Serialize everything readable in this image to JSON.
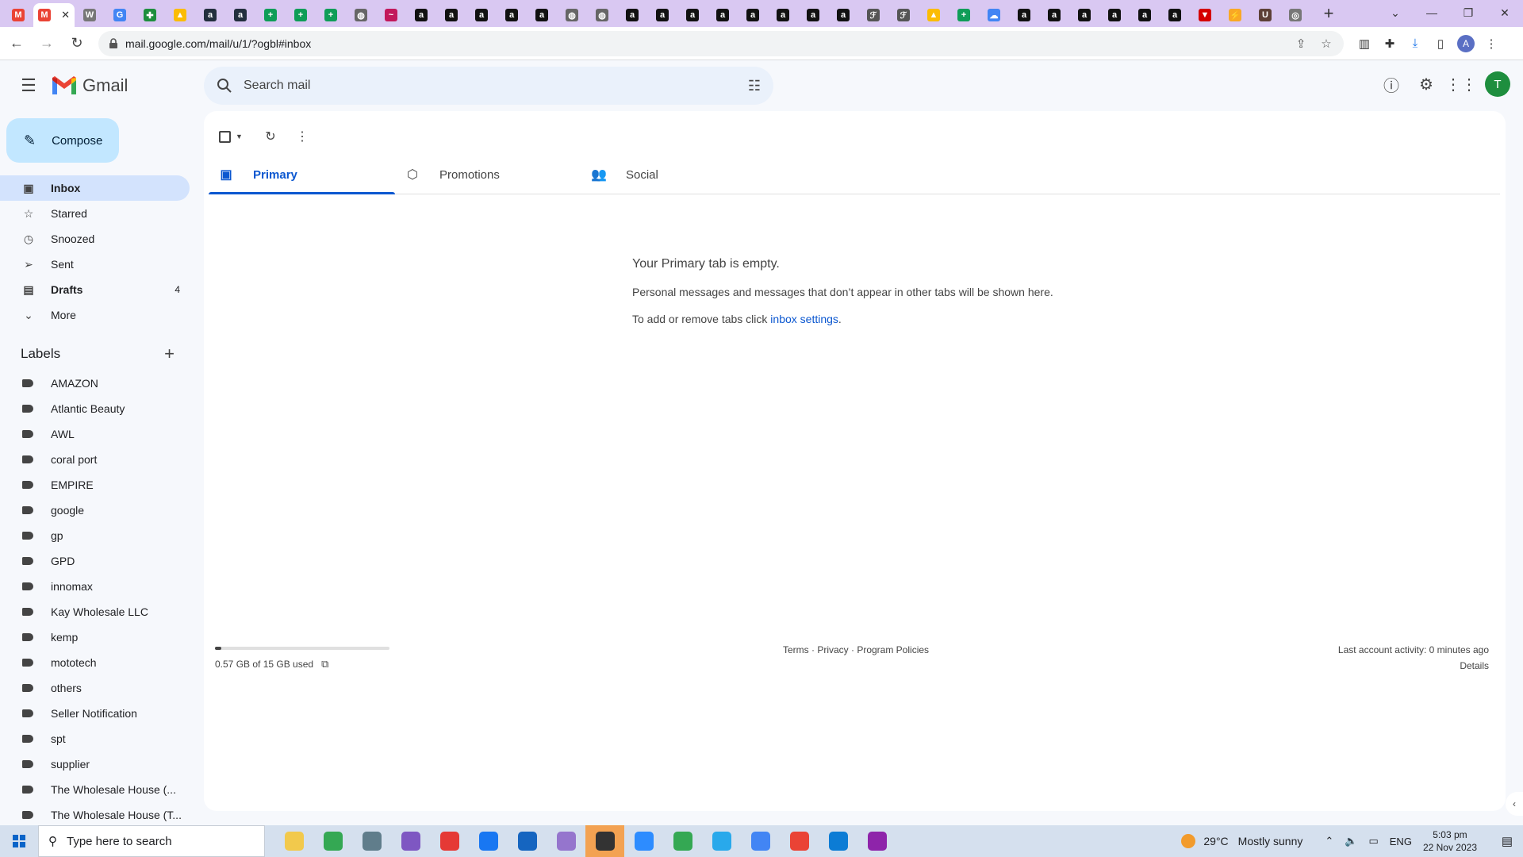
{
  "browser": {
    "tabs": [
      {
        "icon": "gmail-icon",
        "color": "#ea4335",
        "glyph": "M"
      },
      {
        "icon": "gmail-icon",
        "color": "#ea4335",
        "glyph": "M",
        "active": true,
        "close": "✕"
      },
      {
        "icon": "wiki-icon",
        "color": "#777777",
        "glyph": "W"
      },
      {
        "icon": "google-icon",
        "color": "#4285f4",
        "glyph": "G"
      },
      {
        "icon": "puzzle-icon",
        "color": "#1e8e3e",
        "glyph": "✚"
      },
      {
        "icon": "drive-icon",
        "color": "#fbbc04",
        "glyph": "▲"
      },
      {
        "icon": "amazon-icon",
        "color": "#232f3e",
        "glyph": "a"
      },
      {
        "icon": "amazon-icon",
        "color": "#232f3e",
        "glyph": "a"
      },
      {
        "icon": "sheets-icon",
        "color": "#0f9d58",
        "glyph": "+"
      },
      {
        "icon": "sheets-icon",
        "color": "#0f9d58",
        "glyph": "+"
      },
      {
        "icon": "sheets-icon",
        "color": "#0f9d58",
        "glyph": "+"
      },
      {
        "icon": "globe-icon",
        "color": "#666666",
        "glyph": "◍"
      },
      {
        "icon": "site-icon",
        "color": "#c2185b",
        "glyph": "~"
      },
      {
        "icon": "amazon-icon",
        "color": "#111111",
        "glyph": "a"
      },
      {
        "icon": "amazon-icon",
        "color": "#111111",
        "glyph": "a"
      },
      {
        "icon": "amazon-icon",
        "color": "#111111",
        "glyph": "a"
      },
      {
        "icon": "amazon-icon",
        "color": "#111111",
        "glyph": "a"
      },
      {
        "icon": "amazon-icon",
        "color": "#111111",
        "glyph": "a"
      },
      {
        "icon": "globe-icon",
        "color": "#666666",
        "glyph": "◍"
      },
      {
        "icon": "globe-icon",
        "color": "#666666",
        "glyph": "◍"
      },
      {
        "icon": "amazon-icon",
        "color": "#111111",
        "glyph": "a"
      },
      {
        "icon": "amazon-icon",
        "color": "#111111",
        "glyph": "a"
      },
      {
        "icon": "amazon-icon",
        "color": "#111111",
        "glyph": "a"
      },
      {
        "icon": "amazon-icon",
        "color": "#111111",
        "glyph": "a"
      },
      {
        "icon": "amazon-icon",
        "color": "#111111",
        "glyph": "a"
      },
      {
        "icon": "amazon-icon",
        "color": "#111111",
        "glyph": "a"
      },
      {
        "icon": "amazon-icon",
        "color": "#111111",
        "glyph": "a"
      },
      {
        "icon": "amazon-icon",
        "color": "#111111",
        "glyph": "a"
      },
      {
        "icon": "script-icon",
        "color": "#555555",
        "glyph": "ℱ"
      },
      {
        "icon": "script-icon",
        "color": "#555555",
        "glyph": "ℱ"
      },
      {
        "icon": "drive-icon",
        "color": "#fbbc04",
        "glyph": "▲"
      },
      {
        "icon": "sheets-icon",
        "color": "#0f9d58",
        "glyph": "+"
      },
      {
        "icon": "cloud-icon",
        "color": "#4285f4",
        "glyph": "☁"
      },
      {
        "icon": "amazon-icon",
        "color": "#111111",
        "glyph": "a"
      },
      {
        "icon": "amazon-icon",
        "color": "#111111",
        "glyph": "a"
      },
      {
        "icon": "amazon-icon",
        "color": "#111111",
        "glyph": "a"
      },
      {
        "icon": "amazon-icon",
        "color": "#111111",
        "glyph": "a"
      },
      {
        "icon": "amazon-icon",
        "color": "#111111",
        "glyph": "a"
      },
      {
        "icon": "amazon-icon",
        "color": "#111111",
        "glyph": "a"
      },
      {
        "icon": "shield-icon",
        "color": "#d50000",
        "glyph": "▼"
      },
      {
        "icon": "pencil-icon",
        "color": "#f9a825",
        "glyph": "⚡"
      },
      {
        "icon": "ups-icon",
        "color": "#5d4037",
        "glyph": "U"
      },
      {
        "icon": "site-icon",
        "color": "#777777",
        "glyph": "◎"
      }
    ],
    "new_tab": "+",
    "url": "mail.google.com/mail/u/1/?ogbl#inbox",
    "profile_initial": "A"
  },
  "gmail": {
    "product_name": "Gmail",
    "search_placeholder": "Search mail",
    "avatar_initial": "T",
    "compose_label": "Compose",
    "nav": [
      {
        "id": "inbox",
        "label": "Inbox",
        "icon": "inbox-icon",
        "glyph": "▣",
        "active": true
      },
      {
        "id": "starred",
        "label": "Starred",
        "icon": "star-icon",
        "glyph": "☆"
      },
      {
        "id": "snoozed",
        "label": "Snoozed",
        "icon": "clock-icon",
        "glyph": "◷"
      },
      {
        "id": "sent",
        "label": "Sent",
        "icon": "send-icon",
        "glyph": "➢"
      },
      {
        "id": "drafts",
        "label": "Drafts",
        "icon": "draft-icon",
        "glyph": "▤",
        "count": "4",
        "bold": true
      },
      {
        "id": "more",
        "label": "More",
        "icon": "chevron-down-icon",
        "glyph": "⌄"
      }
    ],
    "labels_title": "Labels",
    "labels": [
      "AMAZON",
      "Atlantic Beauty",
      "AWL",
      "coral port",
      "EMPIRE",
      "google",
      "gp",
      "GPD",
      "innomax",
      "Kay Wholesale LLC",
      "kemp",
      "mototech",
      "others",
      "Seller Notification",
      "spt",
      "supplier",
      "The Wholesale House (...",
      "The Wholesale House (T..."
    ],
    "category_tabs": [
      {
        "id": "primary",
        "label": "Primary",
        "icon": "inbox-icon",
        "glyph": "▣",
        "active": true
      },
      {
        "id": "promotions",
        "label": "Promotions",
        "icon": "tag-icon",
        "glyph": "⬡"
      },
      {
        "id": "social",
        "label": "Social",
        "icon": "people-icon",
        "glyph": "👥"
      }
    ],
    "empty_state": {
      "title": "Your Primary tab is empty.",
      "body": "Personal messages and messages that don’t appear in other tabs will be shown here.",
      "settings_prefix": "To add or remove tabs click ",
      "settings_link": "inbox settings",
      "settings_suffix": "."
    },
    "footer": {
      "storage_text": "0.57 GB of 15 GB used",
      "storage_fraction": 0.038,
      "links": "Terms · Privacy · Program Policies",
      "last_activity": "Last account activity: 0 minutes ago",
      "details": "Details"
    }
  },
  "taskbar": {
    "search_placeholder": "Type here to search",
    "apps": [
      {
        "icon": "explorer-icon",
        "color": "#f2c94c"
      },
      {
        "icon": "chrome-icon",
        "color": "#34a853"
      },
      {
        "icon": "calculator-icon",
        "color": "#607d8b"
      },
      {
        "icon": "app-icon",
        "color": "#7e57c2"
      },
      {
        "icon": "youtube-icon",
        "color": "#e53935"
      },
      {
        "icon": "facebook-icon",
        "color": "#1877f2"
      },
      {
        "icon": "store-icon",
        "color": "#1565c0"
      },
      {
        "icon": "snip-icon",
        "color": "#9575cd"
      },
      {
        "icon": "sticky-notes-icon",
        "color": "#333333",
        "highlight": true
      },
      {
        "icon": "zoom-icon",
        "color": "#2d8cff"
      },
      {
        "icon": "chrome-icon",
        "color": "#34a853"
      },
      {
        "icon": "telegram-icon",
        "color": "#29a9eb"
      },
      {
        "icon": "chrome-icon",
        "color": "#4285f4"
      },
      {
        "icon": "chrome-icon",
        "color": "#ea4335"
      },
      {
        "icon": "edge-icon",
        "color": "#0c7cd5"
      },
      {
        "icon": "winrar-icon",
        "color": "#8e24aa"
      }
    ],
    "temperature": "29°C",
    "weather": "Mostly sunny",
    "language": "ENG",
    "time": "5:03 pm",
    "date": "22 Nov 2023"
  }
}
